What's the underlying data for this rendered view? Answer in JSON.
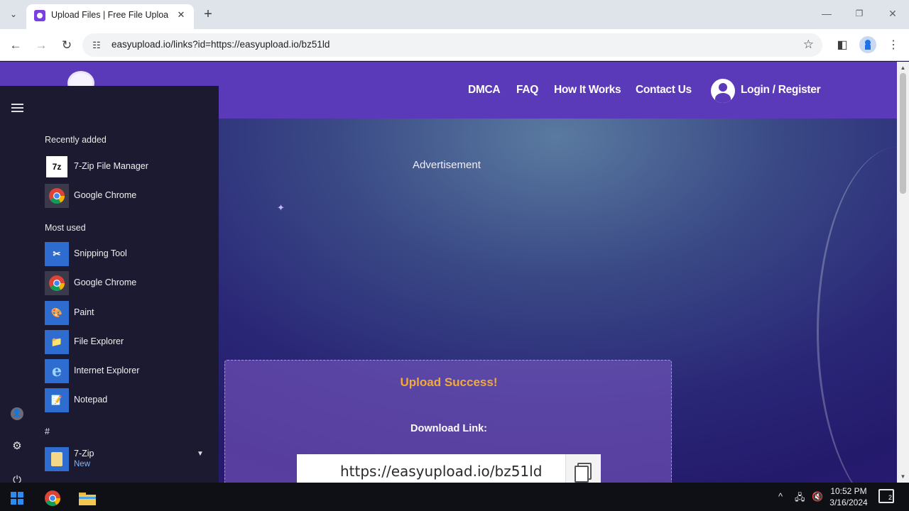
{
  "browser": {
    "tab_title": "Upload Files | Free File Upload",
    "url": "easyupload.io/links?id=https://easyupload.io/bz51ld",
    "new_tab_symbol": "+",
    "tab_close_symbol": "✕"
  },
  "site": {
    "nav": [
      "DMCA",
      "FAQ",
      "How It Works",
      "Contact Us"
    ],
    "login_label": "Login / Register",
    "ad_label": "Advertisement",
    "success_title": "Upload Success!",
    "download_label": "Download Link:",
    "download_url": "https://easyupload.io/bz51ld"
  },
  "start_menu": {
    "recently_added_header": "Recently added",
    "recently_added": [
      {
        "label": "7-Zip File Manager",
        "icon": "7zip-icon",
        "glyph": "7z"
      },
      {
        "label": "Google Chrome",
        "icon": "chrome-icon",
        "glyph": ""
      }
    ],
    "most_used_header": "Most used",
    "most_used": [
      {
        "label": "Snipping Tool",
        "icon": "snipping-tool-icon",
        "glyph": "✂"
      },
      {
        "label": "Google Chrome",
        "icon": "chrome-icon",
        "glyph": ""
      },
      {
        "label": "Paint",
        "icon": "paint-icon",
        "glyph": "🎨"
      },
      {
        "label": "File Explorer",
        "icon": "folder-icon",
        "glyph": "📁"
      },
      {
        "label": "Internet Explorer",
        "icon": "internet-explorer-icon",
        "glyph": "e"
      },
      {
        "label": "Notepad",
        "icon": "notepad-icon",
        "glyph": "📝"
      }
    ],
    "hash_header": "#",
    "seven_zip_folder": {
      "label": "7-Zip",
      "sub": "New"
    }
  },
  "taskbar": {
    "time": "10:52 PM",
    "date": "3/16/2024",
    "notification_count": "2"
  },
  "colors": {
    "header_purple": "#5b3ab9",
    "success_orange": "#f2a93b",
    "start_menu_bg": "#1c1a30"
  }
}
